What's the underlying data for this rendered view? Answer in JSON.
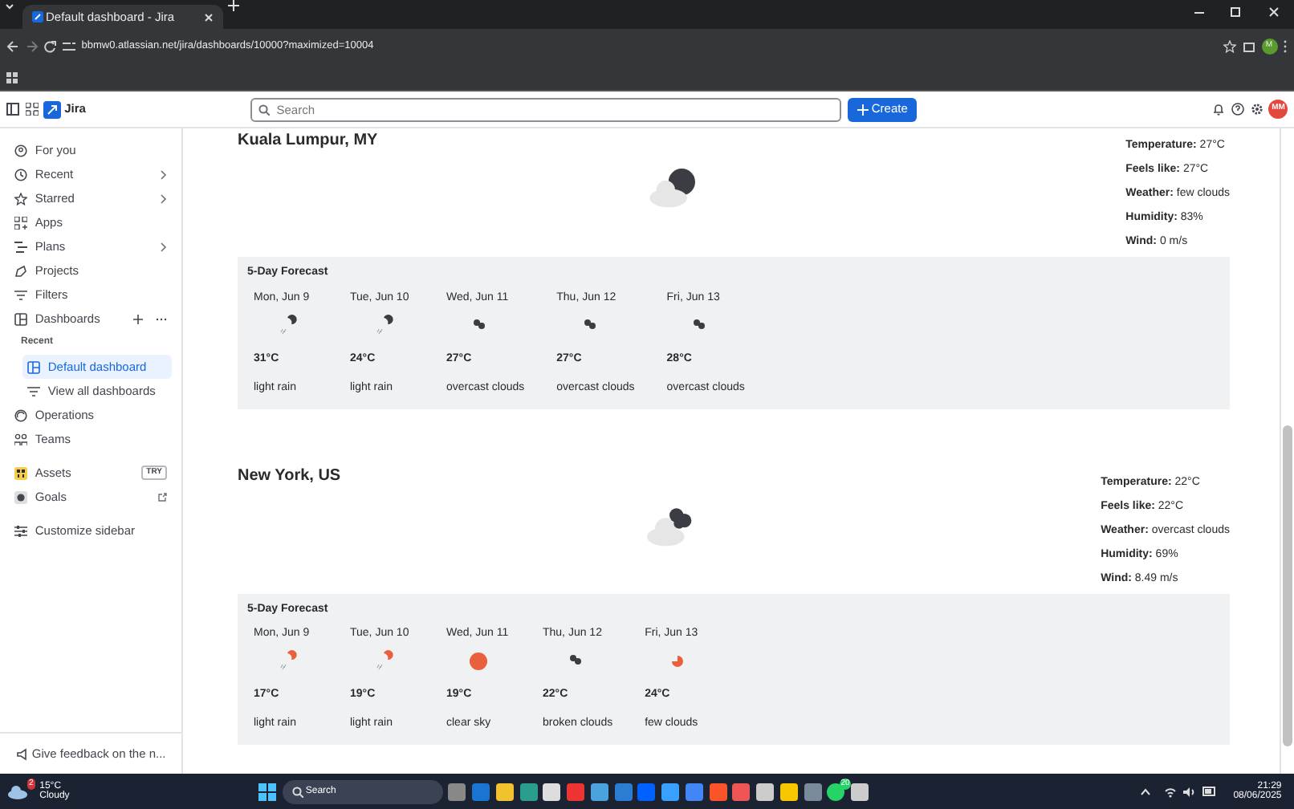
{
  "browser": {
    "tab_title": "Default dashboard - Jira",
    "address": "bbmw0.atlassian.net/jira/dashboards/10000?maximized=10004",
    "profile_initial": "M"
  },
  "topbar": {
    "product": "Jira",
    "search": {
      "placeholder": "Search"
    },
    "create_label": "Create",
    "avatar_initials": "MM"
  },
  "sidebar": {
    "items": [
      {
        "kind": "item",
        "label": "For you",
        "chevron": false,
        "selected": false
      },
      {
        "kind": "item",
        "label": "Recent",
        "chevron": true,
        "selected": false
      },
      {
        "kind": "item",
        "label": "Starred",
        "chevron": true,
        "selected": false
      },
      {
        "kind": "item",
        "label": "Apps",
        "chevron": false,
        "selected": false
      },
      {
        "kind": "item",
        "label": "Plans",
        "chevron": true,
        "selected": false
      },
      {
        "kind": "item",
        "label": "Projects",
        "chevron": false,
        "selected": false
      },
      {
        "kind": "item",
        "label": "Filters",
        "chevron": false,
        "selected": false
      },
      {
        "kind": "dashboards",
        "label": "Dashboards",
        "chevron": false,
        "selected": false
      },
      {
        "kind": "heading",
        "label": "Recent"
      },
      {
        "kind": "sub",
        "label": "Default dashboard",
        "selected": true
      },
      {
        "kind": "sub",
        "label": "View all dashboards",
        "selected": false
      },
      {
        "kind": "item",
        "label": "Operations",
        "chevron": false,
        "selected": false
      },
      {
        "kind": "item",
        "label": "Teams",
        "chevron": false,
        "selected": false
      },
      {
        "kind": "gap"
      },
      {
        "kind": "item",
        "label": "Assets",
        "badge": "TRY",
        "chevron": false,
        "selected": false
      },
      {
        "kind": "item",
        "label": "Goals",
        "external": true,
        "chevron": false,
        "selected": false
      },
      {
        "kind": "gap"
      },
      {
        "kind": "item",
        "label": "Customize sidebar",
        "chevron": false,
        "selected": false
      }
    ],
    "feedback": "Give feedback on the n..."
  },
  "cities": [
    {
      "name": "Kuala Lumpur, MY",
      "icon": {
        "kind": "few",
        "night": true
      },
      "details": [
        {
          "label": "Temperature:",
          "value": "27°C"
        },
        {
          "label": "Feels like:",
          "value": "27°C"
        },
        {
          "label": "Weather:",
          "value": "few clouds"
        },
        {
          "label": "Humidity:",
          "value": "83%"
        },
        {
          "label": "Wind:",
          "value": "0 m/s"
        }
      ],
      "forecast_title": "5-Day Forecast",
      "forecast": [
        {
          "day": "Mon, Jun 9",
          "icon": {
            "kind": "rain",
            "night": true
          },
          "temp": "31°C",
          "desc": "light rain"
        },
        {
          "day": "Tue, Jun 10",
          "icon": {
            "kind": "rain",
            "night": true
          },
          "temp": "24°C",
          "desc": "light rain"
        },
        {
          "day": "Wed, Jun 11",
          "icon": {
            "kind": "clouds"
          },
          "temp": "27°C",
          "desc": "overcast clouds"
        },
        {
          "day": "Thu, Jun 12",
          "icon": {
            "kind": "clouds"
          },
          "temp": "27°C",
          "desc": "overcast clouds"
        },
        {
          "day": "Fri, Jun 13",
          "icon": {
            "kind": "clouds"
          },
          "temp": "28°C",
          "desc": "overcast clouds"
        }
      ]
    },
    {
      "name": "New York, US",
      "icon": {
        "kind": "overcast"
      },
      "details": [
        {
          "label": "Temperature:",
          "value": "22°C"
        },
        {
          "label": "Feels like:",
          "value": "22°C"
        },
        {
          "label": "Weather:",
          "value": "overcast clouds"
        },
        {
          "label": "Humidity:",
          "value": "69%"
        },
        {
          "label": "Wind:",
          "value": "8.49 m/s"
        }
      ],
      "forecast_title": "5-Day Forecast",
      "forecast": [
        {
          "day": "Mon, Jun 9",
          "icon": {
            "kind": "rain",
            "night": false
          },
          "temp": "17°C",
          "desc": "light rain"
        },
        {
          "day": "Tue, Jun 10",
          "icon": {
            "kind": "rain",
            "night": false
          },
          "temp": "19°C",
          "desc": "light rain"
        },
        {
          "day": "Wed, Jun 11",
          "icon": {
            "kind": "clear"
          },
          "temp": "19°C",
          "desc": "clear sky"
        },
        {
          "day": "Thu, Jun 12",
          "icon": {
            "kind": "clouds"
          },
          "temp": "22°C",
          "desc": "broken clouds"
        },
        {
          "day": "Fri, Jun 13",
          "icon": {
            "kind": "few",
            "night": false
          },
          "temp": "24°C",
          "desc": "few clouds"
        }
      ]
    }
  ],
  "taskbar": {
    "weather_temp": "15°C",
    "weather_desc": "Cloudy",
    "weather_badge": "2",
    "search": "Search",
    "chat_badge": "20",
    "time": "21:29",
    "date": "08/06/2025"
  }
}
